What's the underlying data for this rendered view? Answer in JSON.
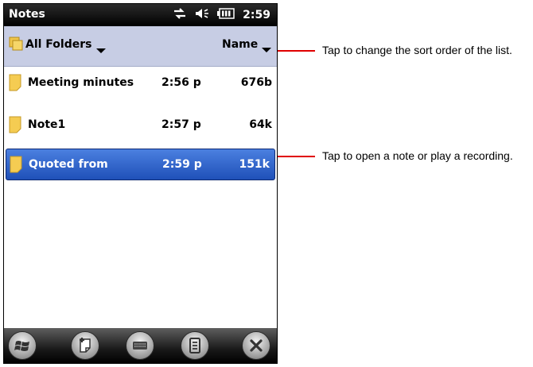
{
  "status": {
    "time": "2:59"
  },
  "app": {
    "title": "Notes"
  },
  "folderbar": {
    "folder": "All Folders",
    "sort": "Name"
  },
  "notes": [
    {
      "name": "Meeting minutes",
      "time": "2:56 p",
      "size": "676b"
    },
    {
      "name": "Note1",
      "time": "2:57 p",
      "size": "64k"
    },
    {
      "name": "Quoted from",
      "time": "2:59 p",
      "size": "151k"
    }
  ],
  "toolbar": {
    "icons": [
      "windows-start-icon",
      "new-note-icon",
      "keyboard-icon",
      "menu-icon",
      "close-icon"
    ]
  },
  "callouts": {
    "sort": "Tap to change the sort order of the list.",
    "open": "Tap to open a note or play a recording."
  },
  "colors": {
    "selection": "#2e63cc",
    "callout_line": "#e00000",
    "folderbar": "#c7cde4"
  }
}
